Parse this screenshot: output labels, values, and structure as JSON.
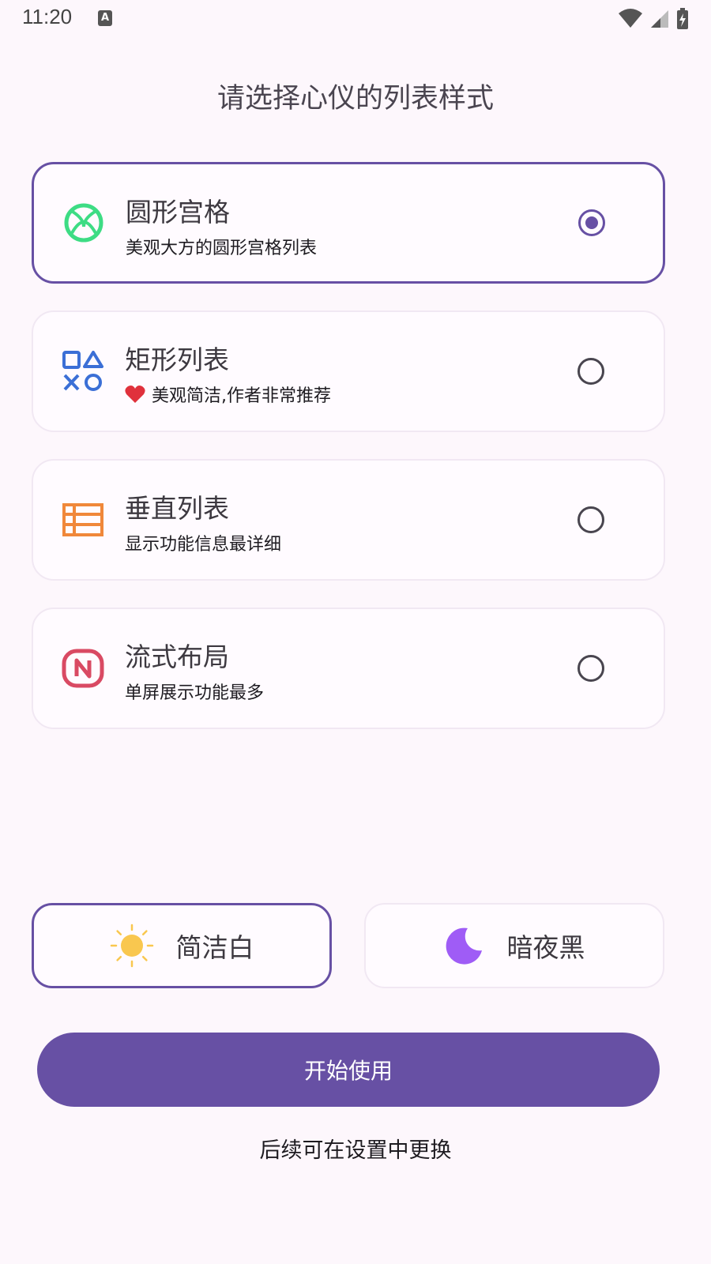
{
  "status_bar": {
    "time": "11:20",
    "notification_icon": "a-icon",
    "right_icons": [
      "wifi-icon",
      "signal-icon",
      "battery-charging-icon"
    ]
  },
  "title": "请选择心仪的列表样式",
  "options": [
    {
      "title": "圆形宫格",
      "desc": "美观大方的圆形宫格列表",
      "icon": "xbox-circle-icon",
      "icon_color": "#3ddc84",
      "selected": true
    },
    {
      "title": "矩形列表",
      "desc": "美观简洁,作者非常推荐",
      "desc_prefix_icon": "heart-icon",
      "icon": "playstation-shapes-icon",
      "icon_color": "#3b6fd6",
      "selected": false
    },
    {
      "title": "垂直列表",
      "desc": "显示功能信息最详细",
      "icon": "table-list-icon",
      "icon_color": "#f0883a",
      "selected": false
    },
    {
      "title": "流式布局",
      "desc": "单屏展示功能最多",
      "icon": "n-badge-icon",
      "icon_color": "#d94a63",
      "selected": false
    }
  ],
  "themes": [
    {
      "label": "简洁白",
      "icon": "sun-icon",
      "icon_color": "#f9c74f",
      "selected": true
    },
    {
      "label": "暗夜黑",
      "icon": "moon-icon",
      "icon_color": "#9f5cf6",
      "selected": false
    }
  ],
  "start_button": "开始使用",
  "footer_note": "后续可在设置中更换",
  "colors": {
    "accent": "#6750a4",
    "background": "#fdf7fc"
  }
}
